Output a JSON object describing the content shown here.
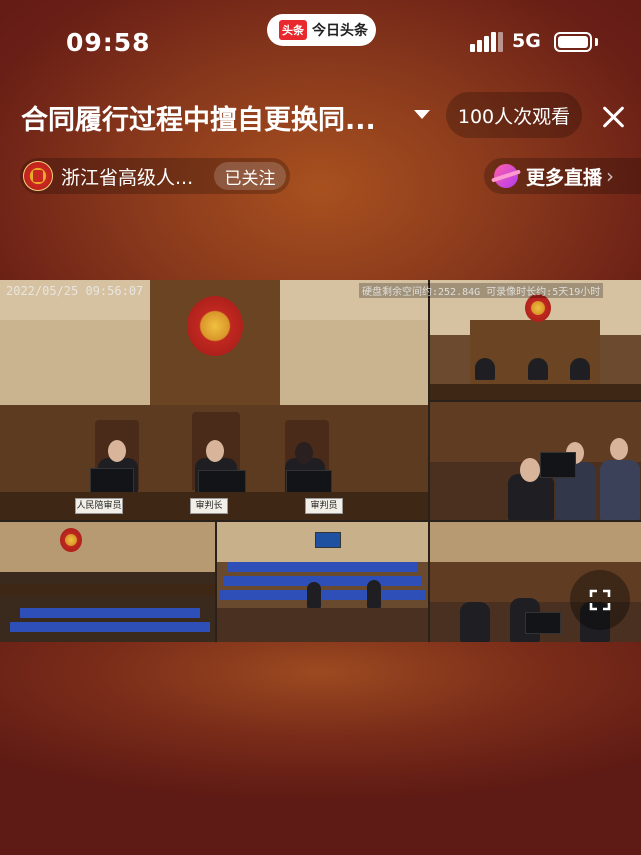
{
  "status_bar": {
    "time": "09:58",
    "app_logo": "头条",
    "app_name": "今日头条",
    "network": "5G"
  },
  "header": {
    "title": "合同履行过程中擅自更换同...",
    "viewers": "100人次观看"
  },
  "channel": {
    "name": "浙江省高级人...",
    "follow_label": "已关注"
  },
  "more_live": {
    "label": "更多直播"
  },
  "video": {
    "timestamp": "2022/05/25 09:56:07",
    "storage_info": "硬盘剩余空间约:252.84G 可录像时长约:5天19小时",
    "nameplates": [
      "人民陪审员",
      "审判长",
      "审判员"
    ]
  },
  "colors": {
    "background": "#6a1f16",
    "accent": "#e8282d"
  },
  "icons": [
    "signal-icon",
    "battery-icon",
    "dropdown-icon",
    "close-icon",
    "court-emblem-avatar",
    "more-live-icon",
    "chevron-right-icon",
    "fullscreen-icon"
  ]
}
